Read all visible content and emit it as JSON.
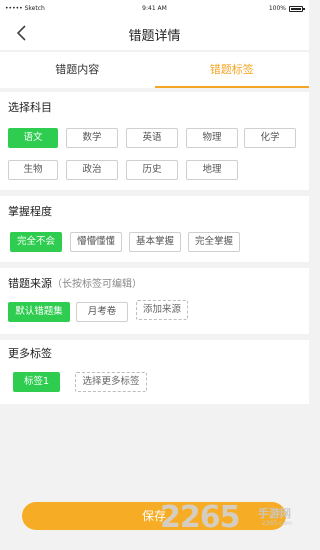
{
  "status": {
    "carrier": "••••• Sketch",
    "time": "9:41 AM",
    "battery": "100%"
  },
  "nav": {
    "title": "错题详情",
    "back_icon": "chevron-left-icon"
  },
  "tabs": [
    {
      "label": "错题内容",
      "active": false
    },
    {
      "label": "错题标签",
      "active": true
    }
  ],
  "subject": {
    "title": "选择科目",
    "options": [
      "语文",
      "数学",
      "英语",
      "物理",
      "化学",
      "生物",
      "政治",
      "历史",
      "地理"
    ],
    "selected": "语文"
  },
  "mastery": {
    "title": "掌握程度",
    "options": [
      "完全不会",
      "懵懵懂懂",
      "基本掌握",
      "完全掌握"
    ],
    "selected": "完全不会"
  },
  "source": {
    "title": "错题来源",
    "hint": "（长按标签可编辑）",
    "options": [
      "默认错题集",
      "月考卷"
    ],
    "selected": "默认错题集",
    "add_label": "添加来源"
  },
  "more_tags": {
    "title": "更多标签",
    "tags": [
      "标签1"
    ],
    "select_label": "选择更多标签"
  },
  "save_label": "保存",
  "watermark": {
    "logo": "2265",
    "brand": "手游网",
    "url": "2265.com"
  },
  "colors": {
    "accent": "#f5a623",
    "selected": "#2ecc4f",
    "save": "#f6ac24"
  }
}
